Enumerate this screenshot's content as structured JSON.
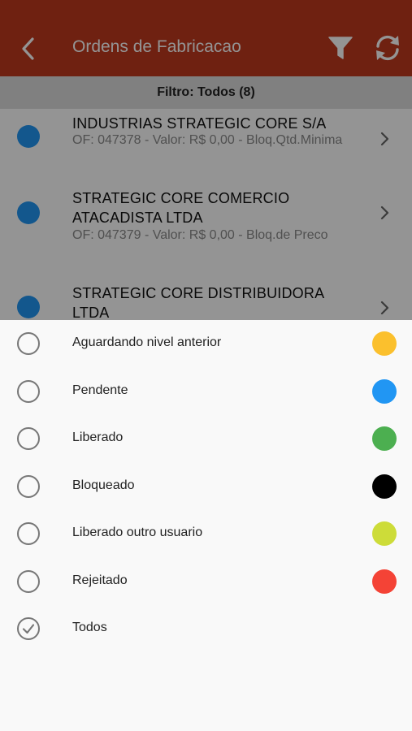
{
  "header": {
    "title": "Ordens de Fabricacao",
    "icons": [
      "back-chevron-icon",
      "filter-funnel-icon",
      "refresh-icon"
    ]
  },
  "filter_bar": {
    "text": "Filtro: Todos (8)"
  },
  "orders": [
    {
      "name": "INDUSTRIAS STRATEGIC CORE S/A",
      "detail": "OF: 047378 - Valor: R$ 0,00 - Bloq.Qtd.Minima",
      "status_color": "#2196f3"
    },
    {
      "name": "STRATEGIC CORE COMERCIO ATACADISTA LTDA",
      "detail": "OF: 047379 - Valor: R$ 0,00 - Bloq.de Preco",
      "status_color": "#2196f3"
    },
    {
      "name": "STRATEGIC CORE DISTRIBUIDORA LTDA",
      "detail": "",
      "status_color": "#2196f3"
    }
  ],
  "status_filter": {
    "options": [
      {
        "label": "Aguardando nivel anterior",
        "color": "#fbc02d",
        "selected": false
      },
      {
        "label": "Pendente",
        "color": "#2196f3",
        "selected": false
      },
      {
        "label": "Liberado",
        "color": "#4caf50",
        "selected": false
      },
      {
        "label": "Bloqueado",
        "color": "#000000",
        "selected": false
      },
      {
        "label": "Liberado outro usuario",
        "color": "#cddc39",
        "selected": false
      },
      {
        "label": "Rejeitado",
        "color": "#f44336",
        "selected": false
      },
      {
        "label": "Todos",
        "color": "",
        "selected": true
      }
    ]
  },
  "colors": {
    "header": "#c0391e",
    "filter_bar": "#dcdcdc",
    "sheet": "#f9f9f9"
  }
}
